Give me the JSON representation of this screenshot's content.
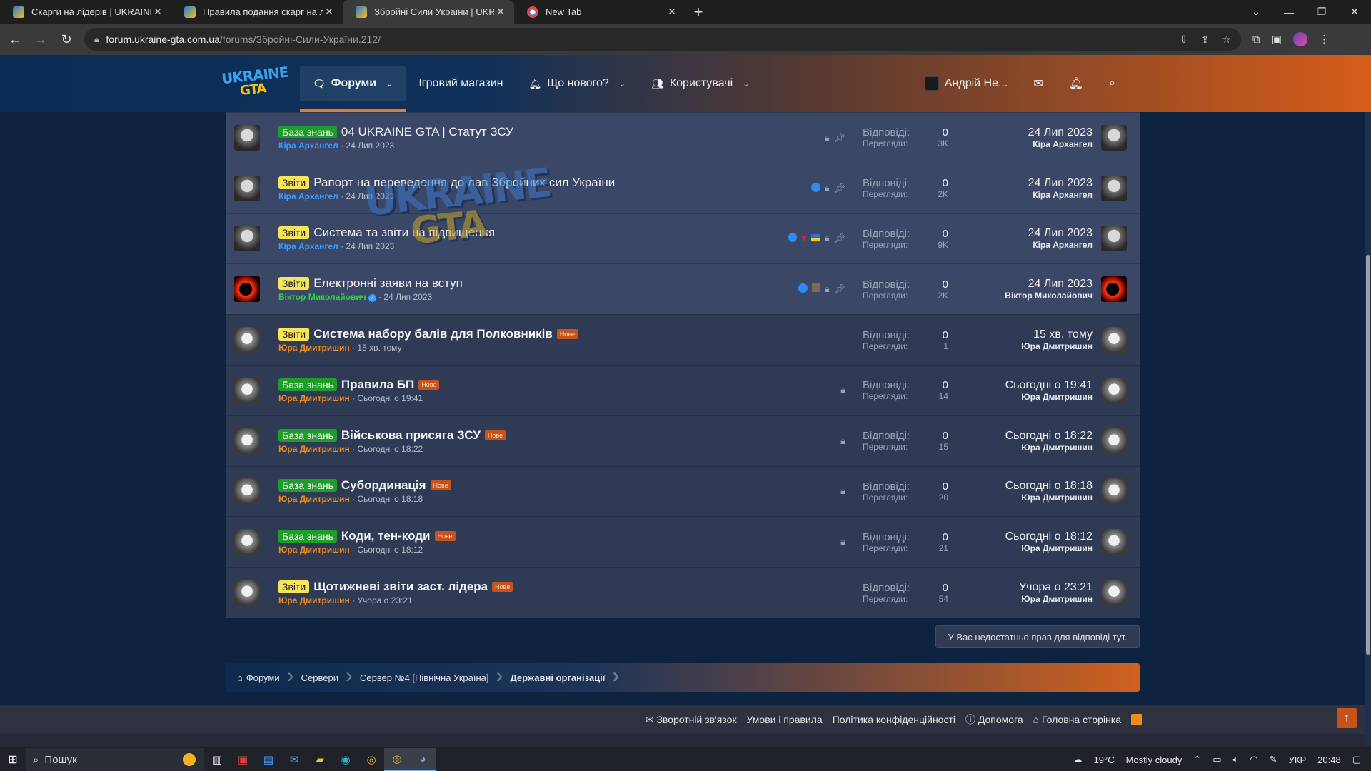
{
  "browser": {
    "tabs": [
      {
        "title": "Скарги на лідерів | UKRAINE GT",
        "active": false
      },
      {
        "title": "Правила подання скарг на ліде",
        "active": false
      },
      {
        "title": "Збройні Сили України | UKRAIN",
        "active": true
      },
      {
        "title": "New Tab",
        "active": false
      }
    ],
    "url_host": "forum.ukraine-gta.com.ua",
    "url_path": "/forums/Збройні-Сили-України.212/"
  },
  "header": {
    "logo_top": "UKRAINE",
    "logo_bottom": "GTA",
    "nav": [
      {
        "label": "Форуми",
        "active": true,
        "dropdown": true
      },
      {
        "label": "Ігровий магазин",
        "active": false,
        "dropdown": false
      },
      {
        "label": "Що нового?",
        "active": false,
        "dropdown": true
      },
      {
        "label": "Користувачі",
        "active": false,
        "dropdown": true
      }
    ],
    "username": "Андрій Не..."
  },
  "threads": [
    {
      "prefix": "База знань",
      "prefix_color": "green",
      "title": "04 UKRAINE GTA | Статут ЗСУ",
      "bold": false,
      "new": false,
      "author": "Кіра Архангел",
      "author_color": "blue",
      "date": "24 Лип 2023",
      "replies": "0",
      "views": "3K",
      "last_time": "24 Лип 2023",
      "last_author": "Кіра Архангел",
      "sticky": true,
      "avatar": "anime"
    },
    {
      "prefix": "Звіти",
      "prefix_color": "yellow",
      "title": "Рапорт на переведення до лав Збройних сил України",
      "bold": false,
      "new": false,
      "author": "Кіра Архангел",
      "author_color": "blue",
      "date": "24 Лип 2023",
      "replies": "0",
      "views": "2K",
      "last_time": "24 Лип 2023",
      "last_author": "Кіра Архангел",
      "sticky": true,
      "avatar": "anime"
    },
    {
      "prefix": "Звіти",
      "prefix_color": "yellow",
      "title": "Система та звіти на підвищення",
      "bold": false,
      "new": false,
      "author": "Кіра Архангел",
      "author_color": "blue",
      "date": "24 Лип 2023",
      "replies": "0",
      "views": "9K",
      "last_time": "24 Лип 2023",
      "last_author": "Кіра Архангел",
      "sticky": true,
      "avatar": "anime"
    },
    {
      "prefix": "Звіти",
      "prefix_color": "yellow",
      "title": "Електронні заяви на вступ",
      "bold": false,
      "new": false,
      "author": "Віктор Миколайович",
      "author_color": "green",
      "date": "24 Лип 2023",
      "replies": "0",
      "views": "2K",
      "last_time": "24 Лип 2023",
      "last_author": "Віктор Миколайович",
      "sticky": true,
      "avatar": "eclipse"
    },
    {
      "prefix": "Звіти",
      "prefix_color": "yellow",
      "title": "Система набору балів для Полковників",
      "bold": true,
      "new": true,
      "author": "Юра Дмитришин",
      "author_color": "orange",
      "date": "15 хв. тому",
      "replies": "0",
      "views": "1",
      "last_time": "15 хв. тому",
      "last_author": "Юра Дмитришин",
      "sticky": false,
      "avatar": "anime2"
    },
    {
      "prefix": "База знань",
      "prefix_color": "green",
      "title": "Правила БП",
      "bold": true,
      "new": true,
      "author": "Юра Дмитришин",
      "author_color": "orange",
      "date": "Сьогодні о 19:41",
      "replies": "0",
      "views": "14",
      "last_time": "Сьогодні о 19:41",
      "last_author": "Юра Дмитришин",
      "sticky": false,
      "avatar": "anime2"
    },
    {
      "prefix": "База знань",
      "prefix_color": "green",
      "title": "Військова присяга ЗСУ",
      "bold": true,
      "new": true,
      "author": "Юра Дмитришин",
      "author_color": "orange",
      "date": "Сьогодні о 18:22",
      "replies": "0",
      "views": "15",
      "last_time": "Сьогодні о 18:22",
      "last_author": "Юра Дмитришин",
      "sticky": false,
      "avatar": "anime2"
    },
    {
      "prefix": "База знань",
      "prefix_color": "green",
      "title": "Субординація",
      "bold": true,
      "new": true,
      "author": "Юра Дмитришин",
      "author_color": "orange",
      "date": "Сьогодні о 18:18",
      "replies": "0",
      "views": "20",
      "last_time": "Сьогодні о 18:18",
      "last_author": "Юра Дмитришин",
      "sticky": false,
      "avatar": "anime2"
    },
    {
      "prefix": "База знань",
      "prefix_color": "green",
      "title": "Коди, тен-коди",
      "bold": true,
      "new": true,
      "author": "Юра Дмитришин",
      "author_color": "orange",
      "date": "Сьогодні о 18:12",
      "replies": "0",
      "views": "21",
      "last_time": "Сьогодні о 18:12",
      "last_author": "Юра Дмитришин",
      "sticky": false,
      "avatar": "anime2"
    },
    {
      "prefix": "Звіти",
      "prefix_color": "yellow",
      "title": "Щотижневі звіти заст. лідера",
      "bold": true,
      "new": true,
      "author": "Юра Дмитришин",
      "author_color": "orange",
      "date": "Учора о 23:21",
      "replies": "0",
      "views": "54",
      "last_time": "Учора о 23:21",
      "last_author": "Юра Дмитришин",
      "sticky": false,
      "avatar": "anime2"
    }
  ],
  "labels": {
    "replies": "Відповіді:",
    "views": "Перегляди:",
    "new_badge": "Нове",
    "no_permission": "У Вас недостатньо прав для відповіді тут."
  },
  "watermark": {
    "top": "UKRAINE",
    "bottom": "GTA"
  },
  "breadcrumbs": [
    "Форуми",
    "Сервери",
    "Сервер №4 [Північна Україна]",
    "Державні організації"
  ],
  "footer": [
    "Зворотній зв'язок",
    "Умови і правила",
    "Політика конфіденційності",
    "Допомога",
    "Головна сторінка"
  ],
  "taskbar": {
    "search": "Пошук",
    "weather_temp": "19°C",
    "weather_text": "Mostly cloudy",
    "lang": "УКР",
    "time": "20:48"
  },
  "colors": {
    "accent_orange": "#d55d1a",
    "header_blue": "#0a2c55",
    "prefix_green": "#1f9d2a",
    "prefix_yellow": "#f6e55a"
  }
}
